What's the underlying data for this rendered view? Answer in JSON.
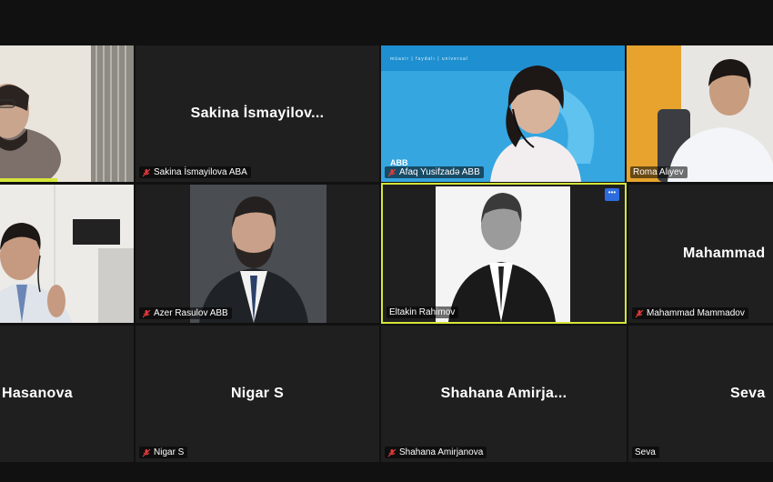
{
  "participants": [
    {
      "tile": "r1c1",
      "display_name": "",
      "tag": "",
      "muted": false
    },
    {
      "tile": "r1c2",
      "display_name": "Sakina  İsmayilov...",
      "tag": "Sakina İsmayilova  ABA",
      "muted": true
    },
    {
      "tile": "r1c3",
      "display_name": "",
      "tag": "Afaq Yusifzadə ABB",
      "muted": true
    },
    {
      "tile": "r1c4",
      "display_name": "",
      "tag": "Roma Aliyev",
      "muted": false
    },
    {
      "tile": "r2c1",
      "display_name": "",
      "tag": "",
      "muted": false
    },
    {
      "tile": "r2c2",
      "display_name": "",
      "tag": "Azer Rasulov ABB",
      "muted": true
    },
    {
      "tile": "r2c3",
      "display_name": "",
      "tag": "Eltakin Rahimov",
      "muted": false,
      "active": true
    },
    {
      "tile": "r2c4",
      "display_name": "Mahammad",
      "tag": "Mahammad Mammadov",
      "muted": true
    },
    {
      "tile": "r3c1",
      "display_name": "Hasanova",
      "tag": "",
      "muted": false
    },
    {
      "tile": "r3c2",
      "display_name": "Nigar S",
      "tag": "Nigar S",
      "muted": true
    },
    {
      "tile": "r3c3",
      "display_name": "Shahana  Amirja...",
      "tag": "Shahana Amirjanova",
      "muted": true
    },
    {
      "tile": "r3c4",
      "display_name": "Seva",
      "tag": "Seva",
      "muted": false
    }
  ],
  "banner": {
    "text": "müasir | faydalı | universal",
    "logo": "ABB"
  },
  "colors": {
    "active_border": "#d4e63a",
    "muted_icon": "#e03b3b",
    "tile_bg": "#1f1f1f",
    "more_button": "#2d6cdf"
  },
  "icons": {
    "muted": "mic-muted-icon",
    "more": "more-options-icon"
  }
}
